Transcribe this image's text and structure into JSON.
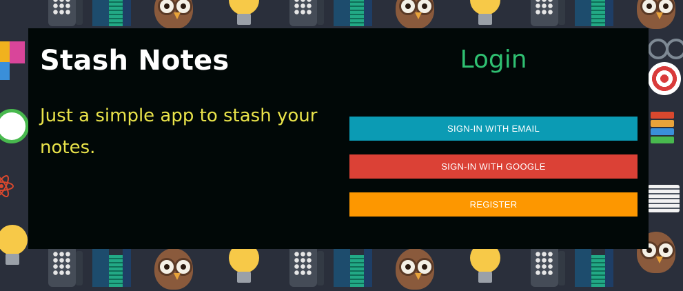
{
  "app": {
    "title": "Stash Notes",
    "tagline": "Just a simple app to stash your notes."
  },
  "login": {
    "heading": "Login",
    "buttons": {
      "email": "Sign-in with Email",
      "google": "Sign-in with Google",
      "register": "Register"
    }
  },
  "colors": {
    "background": "#2a2f3b",
    "card": "#010807",
    "title": "#ffffff",
    "tagline": "#e9e34a",
    "login_heading": "#2fbf71",
    "email_button": "#0b9bb4",
    "google_button": "#db4136",
    "register_button": "#fd9700"
  },
  "background_icons": [
    "owl-icon",
    "light-bulb-icon",
    "phone-icon",
    "city-icon",
    "puzzle-icon",
    "glasses-icon",
    "target-icon",
    "books-icon",
    "alarm-clock-icon",
    "atom-icon",
    "newspaper-icon"
  ]
}
